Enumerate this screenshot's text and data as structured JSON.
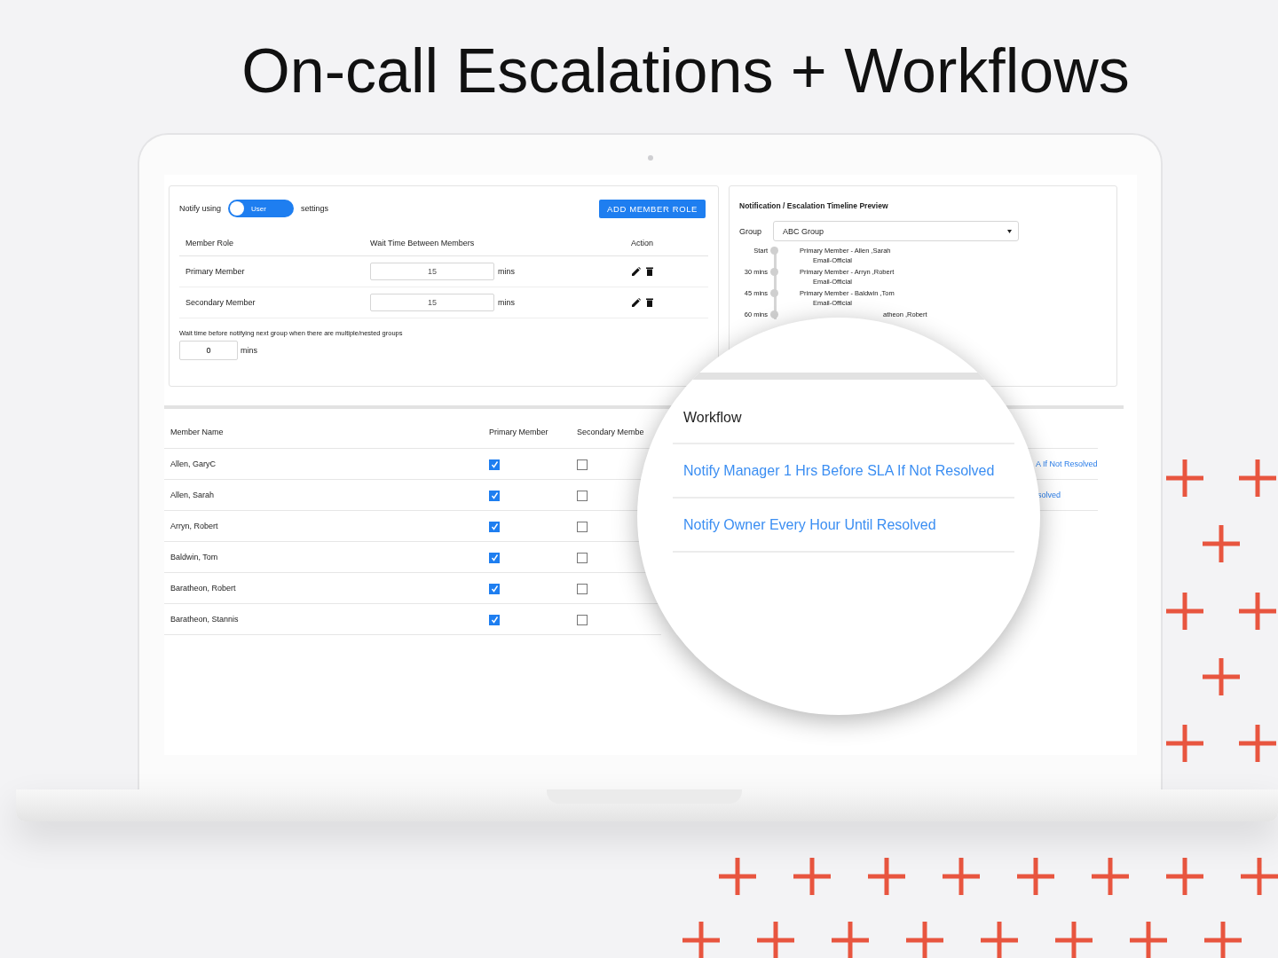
{
  "headline": "On-call Escalations + Workflows",
  "notify": {
    "label_before": "Notify using",
    "toggle": {
      "label": "User",
      "on": true
    },
    "label_after": "settings"
  },
  "add_button": "ADD MEMBER ROLE",
  "roles": {
    "columns": [
      "Member Role",
      "Wait Time Between Members",
      "Action"
    ],
    "rows": [
      {
        "role": "Primary Member",
        "wait": "15",
        "unit": "mins"
      },
      {
        "role": "Secondary Member",
        "wait": "15",
        "unit": "mins"
      }
    ]
  },
  "group_wait": {
    "note": "Wait time before notifying next group when there are multiple/nested groups",
    "value": "0",
    "unit": "mins"
  },
  "timeline": {
    "title": "Notification / Escalation Timeline Preview",
    "group_label": "Group",
    "group_value": "ABC Group",
    "entries": [
      {
        "time": "Start",
        "member": "Primary Member - Allen ,Sarah",
        "channel": "Email-Official"
      },
      {
        "time": "30 mins",
        "member": "Primary Member - Arryn ,Robert",
        "channel": "Email-Official"
      },
      {
        "time": "45 mins",
        "member": "Primary Member - Baldwin ,Tom",
        "channel": "Email-Official"
      },
      {
        "time": "60 mins",
        "member": "atheon ,Robert"
      }
    ]
  },
  "members": {
    "columns": [
      "Member Name",
      "Primary Member",
      "Secondary Membe"
    ],
    "rows": [
      {
        "name": "Allen, GaryC",
        "primary": true,
        "secondary": false
      },
      {
        "name": "Allen, Sarah",
        "primary": true,
        "secondary": false
      },
      {
        "name": "Arryn, Robert",
        "primary": true,
        "secondary": false
      },
      {
        "name": "Baldwin, Tom",
        "primary": true,
        "secondary": false
      },
      {
        "name": "Baratheon, Robert",
        "primary": true,
        "secondary": false
      },
      {
        "name": "Baratheon, Stannis",
        "primary": true,
        "secondary": false
      }
    ]
  },
  "workflow_rows": [
    "A If Not Resolved",
    "solved"
  ],
  "magnifier": {
    "title": "Workflow",
    "items": [
      "Notify Manager 1 Hrs Before SLA If Not Resolved",
      "Notify Owner Every Hour Until Resolved"
    ]
  }
}
